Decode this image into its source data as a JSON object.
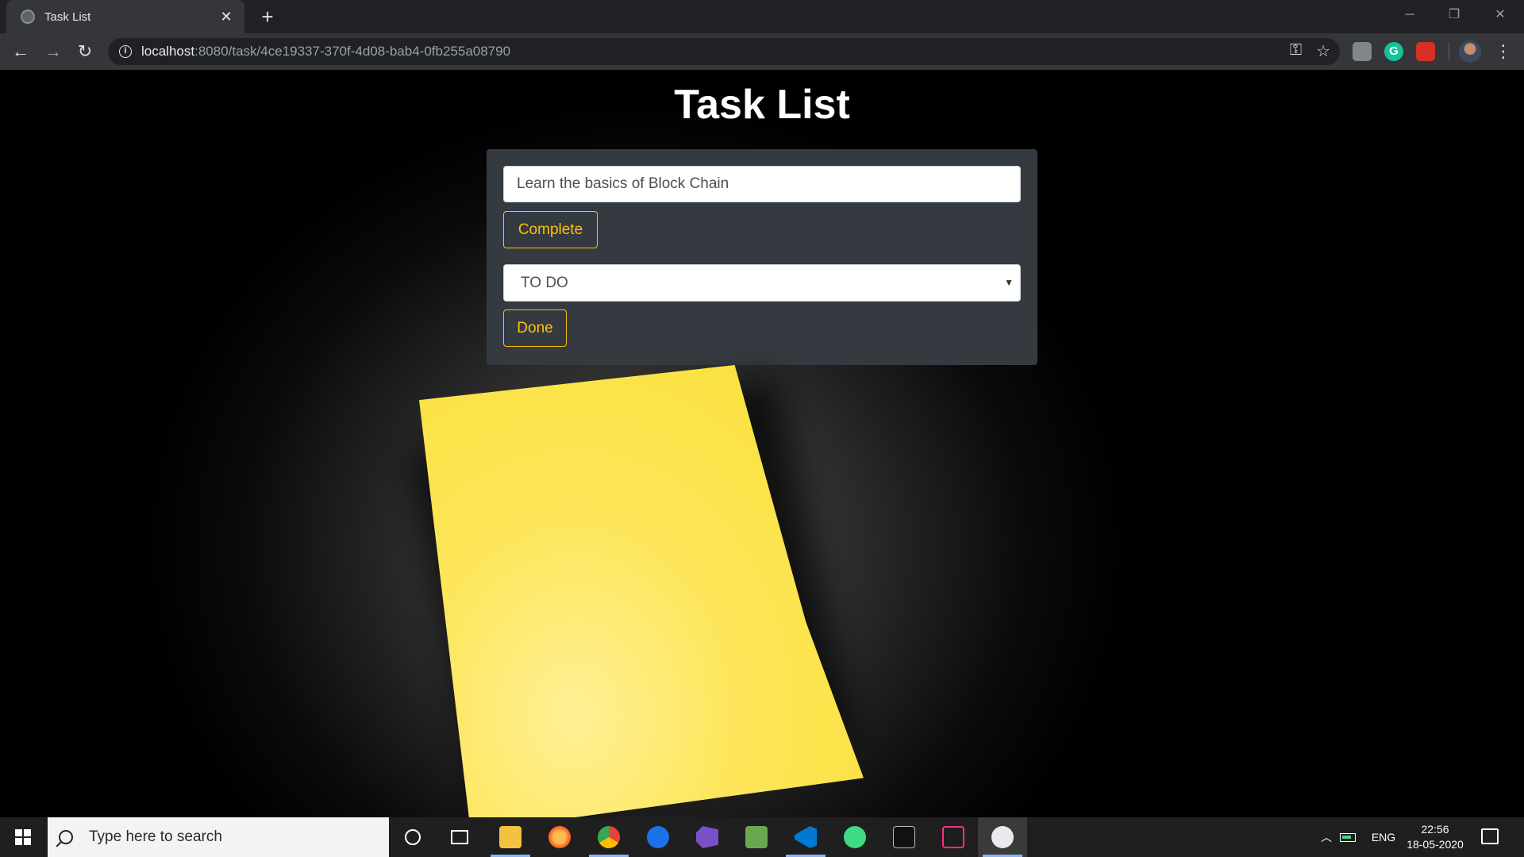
{
  "browser": {
    "tab_title": "Task List",
    "tab_close": "✕",
    "new_tab": "+",
    "url_host": "localhost",
    "url_path": ":8080/task/4ce19337-370f-4d08-bab4-0fb255a08790",
    "window_controls": [
      "─",
      "❐",
      "✕"
    ],
    "icons": [
      "back-arrow-icon",
      "forward-arrow-icon",
      "reload-icon",
      "info-icon",
      "key-icon",
      "star-icon",
      "extension-icon",
      "grammarly-icon",
      "extension-red-icon",
      "avatar",
      "menu-dots-icon"
    ]
  },
  "page": {
    "title": "Task List",
    "task_value": "Learn the basics of Block Chain",
    "complete_label": "Complete",
    "status_selected": "TO DO",
    "done_label": "Done",
    "note_color": "#fde65a",
    "accent": "#ffc107"
  },
  "taskbar": {
    "search_placeholder": "Type here to search",
    "apps": [
      "cortana-icon",
      "task-view-icon",
      "file-explorer-icon",
      "firefox-icon",
      "chrome-icon",
      "edge-icon",
      "visual-studio-icon",
      "notepad-plus-plus-icon",
      "vscode-icon",
      "android-studio-icon",
      "command-prompt-icon",
      "terminal-icon",
      "photos-icon"
    ],
    "language": "ENG",
    "time": "22:56",
    "date": "18-05-2020"
  }
}
